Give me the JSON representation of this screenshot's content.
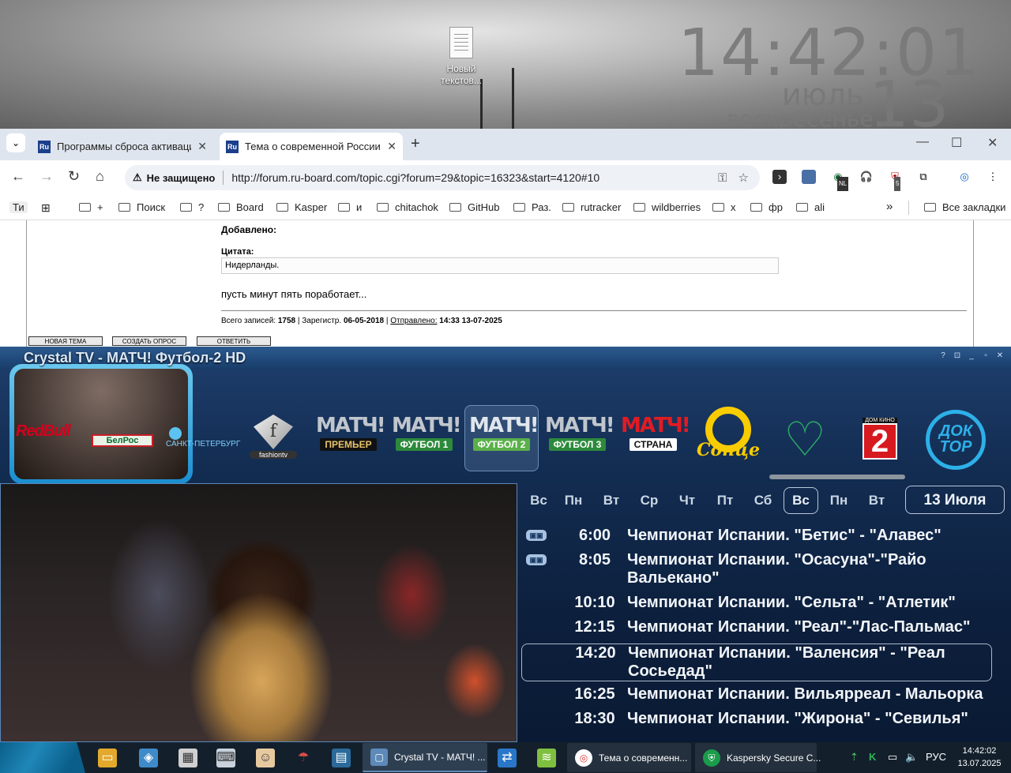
{
  "desktop": {
    "icon_label": "Новый текстов...",
    "clock": {
      "time": "14:42:01",
      "month": "июль",
      "day": "13",
      "weekday": "воскресенье"
    }
  },
  "browser": {
    "tabs": [
      {
        "favicon": "Ru",
        "title": "Программы сброса активации"
      },
      {
        "favicon": "Ru",
        "title": "Тема о современной России -"
      }
    ],
    "security": "Не защищено",
    "url": "http://forum.ru-board.com/topic.cgi?forum=29&topic=16323&start=4120#10",
    "extension_badge": "5",
    "extension_nl": "NL",
    "bookmarks": [
      "Ти",
      "+",
      "Поиск",
      "?",
      "Board",
      "Kasper",
      "и",
      "chitachok",
      "GitHub",
      "Раз.",
      "rutracker",
      "wildberries",
      "x",
      "фр",
      "ali"
    ],
    "all_bookmarks": "Все закладки"
  },
  "forum": {
    "added_label": "Добавлено:",
    "quote_label": "Цитата:",
    "quote_text": "Нидерланды.",
    "post_text": "пусть минут пять поработает...",
    "meta_total_label": "Всего записей:",
    "meta_total": "1758",
    "meta_reg_label": "Зарегистр.",
    "meta_reg": "06-05-2018",
    "meta_sent_label": "Отправлено:",
    "meta_sent": "14:33 13-07-2025",
    "buttons": [
      "НОВАЯ ТЕМА",
      "СОЗДАТЬ ОПРОС",
      "ОТВЕТИТЬ"
    ]
  },
  "crystal_tv": {
    "title": "Crystal TV - МАТЧ! Футбол-2 HD",
    "window_buttons": [
      "?",
      "⊡",
      "_",
      "▫",
      "✕"
    ],
    "sponsors": [
      "RedBull",
      "БелРос",
      "САНКТ-ПЕТЕРБУРГ"
    ],
    "channels": [
      {
        "name": "fashiontv",
        "logo_text": "f"
      },
      {
        "top": "МАТЧ!",
        "bottom": "ПРЕМЬЕР"
      },
      {
        "top": "МАТЧ!",
        "bottom": "ФУТБОЛ 1"
      },
      {
        "top": "МАТЧ!",
        "bottom": "ФУТБОЛ 2"
      },
      {
        "top": "МАТЧ!",
        "bottom": "ФУТБОЛ 3"
      },
      {
        "top": "МАТЧ!",
        "bottom": "СТРАНА"
      },
      {
        "name": "Сонце"
      },
      {
        "name": "heart"
      },
      {
        "top": "ДОМ КИНО",
        "num": "2"
      },
      {
        "name": "ДОК ТОР"
      }
    ],
    "days": [
      "Вс",
      "Пн",
      "Вт",
      "Ср",
      "Чт",
      "Пт",
      "Сб",
      "Вс",
      "Пн",
      "Вт"
    ],
    "selected_day_index": 7,
    "date": "13 Июля",
    "schedule": [
      {
        "time": "6:00",
        "title": "Чемпионат Испании. \"Бетис\" - \"Алавес\"",
        "icon": true
      },
      {
        "time": "8:05",
        "title": "Чемпионат Испании. \"Осасуна\"-\"Райо Вальекано\"",
        "icon": true
      },
      {
        "time": "10:10",
        "title": "Чемпионат Испании. \"Сельта\" - \"Атлетик\"",
        "icon": false
      },
      {
        "time": "12:15",
        "title": "Чемпионат Испании. \"Реал\"-\"Лас-Пальмас\"",
        "icon": false
      },
      {
        "time": "14:20",
        "title": "Чемпионат Испании. \"Валенсия\" - \"Реал Сосьедад\"",
        "icon": false,
        "current": true
      },
      {
        "time": "16:25",
        "title": "Чемпионат Испании. Вильярреал - Мальорка",
        "icon": false
      },
      {
        "time": "18:30",
        "title": "Чемпионат Испании. \"Жирона\" - \"Севилья\"",
        "icon": false
      }
    ]
  },
  "taskbar": {
    "windows": [
      {
        "title": "Crystal TV - МАТЧ! ..."
      },
      {
        "title": "Тема о современн..."
      },
      {
        "title": "Kaspersky Secure C..."
      }
    ],
    "lang": "РУС",
    "time": "14:42:02",
    "date": "13.07.2025"
  }
}
